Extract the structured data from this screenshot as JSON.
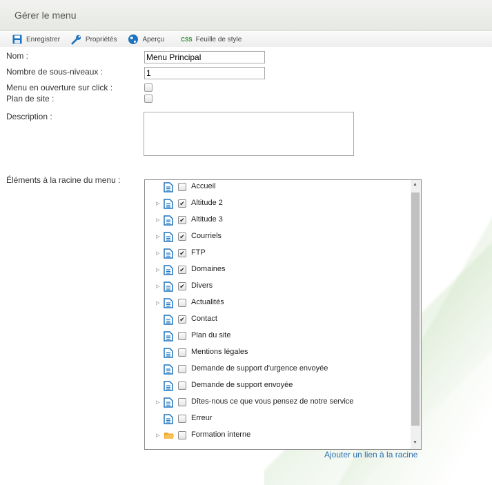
{
  "page": {
    "title": "Gérer le menu"
  },
  "toolbar": {
    "save": "Enregistrer",
    "properties": "Propriétés",
    "preview": "Aperçu",
    "stylesheet": "Feuille de style",
    "css_badge": "css"
  },
  "form": {
    "name_label": "Nom :",
    "name_value": "Menu Principal",
    "sublevels_label": "Nombre de sous-niveaux :",
    "sublevels_value": "1",
    "open_on_click_label": "Menu en ouverture sur click :",
    "sitemap_label": "Plan de site :",
    "description_label": "Description :",
    "root_items_label": "Éléments à la racine du menu :"
  },
  "tree": {
    "items": [
      {
        "label": "Accueil",
        "expandable": false,
        "checked": false,
        "icon": "page-icon"
      },
      {
        "label": "Altitude 2",
        "expandable": true,
        "checked": true,
        "icon": "page-icon"
      },
      {
        "label": "Altitude 3",
        "expandable": true,
        "checked": true,
        "icon": "page-icon"
      },
      {
        "label": "Courriels",
        "expandable": true,
        "checked": true,
        "icon": "page-icon"
      },
      {
        "label": "FTP",
        "expandable": true,
        "checked": true,
        "icon": "page-icon"
      },
      {
        "label": "Domaines",
        "expandable": true,
        "checked": true,
        "icon": "page-icon"
      },
      {
        "label": "Divers",
        "expandable": true,
        "checked": true,
        "icon": "page-icon"
      },
      {
        "label": "Actualités",
        "expandable": true,
        "checked": false,
        "icon": "page-icon"
      },
      {
        "label": "Contact",
        "expandable": false,
        "checked": true,
        "icon": "page-icon"
      },
      {
        "label": "Plan du site",
        "expandable": false,
        "checked": false,
        "icon": "page-icon"
      },
      {
        "label": "Mentions légales",
        "expandable": false,
        "checked": false,
        "icon": "page-icon"
      },
      {
        "label": "Demande de support d'urgence envoyée",
        "expandable": false,
        "checked": false,
        "icon": "page-icon"
      },
      {
        "label": "Demande de support envoyée",
        "expandable": false,
        "checked": false,
        "icon": "page-icon"
      },
      {
        "label": "Dîtes-nous ce que vous pensez de notre service",
        "expandable": true,
        "checked": false,
        "icon": "page-icon"
      },
      {
        "label": "Erreur",
        "expandable": false,
        "checked": false,
        "icon": "page-icon"
      },
      {
        "label": "Formation interne",
        "expandable": true,
        "checked": false,
        "icon": "folder-icon"
      }
    ],
    "add_link": "Ajouter un lien à la racine"
  },
  "colors": {
    "accent": "#1e73be",
    "folder": "#f0a830",
    "link": "#2a6fb0"
  }
}
